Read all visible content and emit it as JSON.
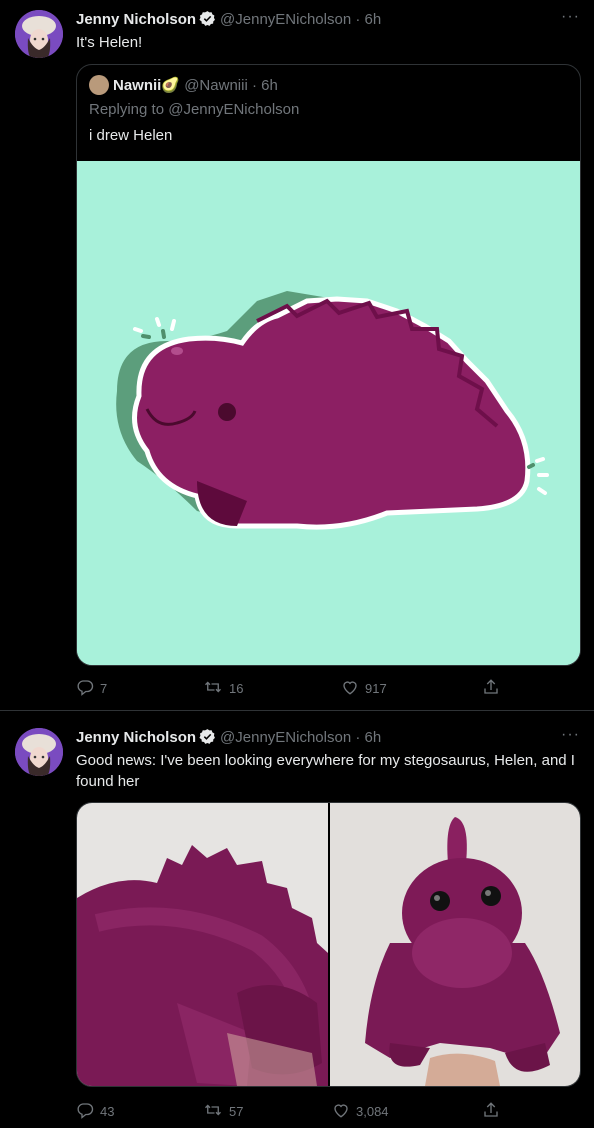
{
  "tweets": [
    {
      "author_name": "Jenny Nicholson",
      "handle_time": "@JennyENicholson · 6h",
      "more": "···",
      "text": "It's Helen!",
      "quote": {
        "author_name": "Nawnii🥑",
        "handle_time": "@Nawniii · 6h",
        "replying_prefix": "Replying to ",
        "replying_handle": "@JennyENicholson",
        "text": "i drew Helen"
      },
      "replies": "7",
      "retweets": "16",
      "likes": "917"
    },
    {
      "author_name": "Jenny Nicholson",
      "handle_time": "@JennyENicholson · 6h",
      "more": "···",
      "text": "Good news: I've been looking everywhere for my stegosaurus, Helen, and I found her",
      "replies": "43",
      "retweets": "57",
      "likes": "3,084"
    }
  ],
  "colors": {
    "background": "#000000",
    "text": "#e7e9ea",
    "secondary": "#71767b",
    "verified": "#e7e9ea",
    "drawing_background": "#a8f1da",
    "helen_purple": "#8c1f63"
  },
  "icons": [
    "verified-badge-icon",
    "reply-icon",
    "retweet-icon",
    "like-icon",
    "share-icon",
    "more-icon"
  ]
}
